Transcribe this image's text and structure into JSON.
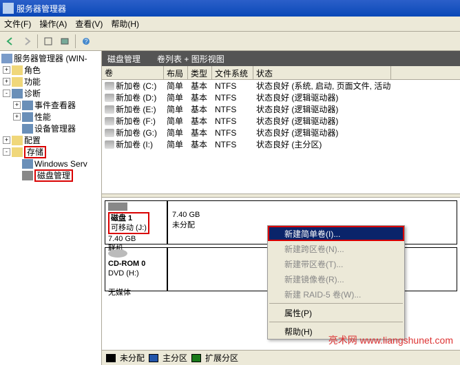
{
  "titlebar": {
    "title": "服务器管理器"
  },
  "menubar": {
    "file": "文件(F)",
    "action": "操作(A)",
    "view": "查看(V)",
    "help": "帮助(H)"
  },
  "tree": {
    "root": "服务器管理器 (WIN-",
    "roles": "角色",
    "features": "功能",
    "diag": "诊断",
    "eventviewer": "事件查看器",
    "perf": "性能",
    "devmgr": "设备管理器",
    "config": "配置",
    "storage": "存储",
    "winserv": "Windows Serv",
    "diskmgmt": "磁盘管理"
  },
  "header": {
    "title": "磁盘管理",
    "sub": "卷列表 + 图形视图"
  },
  "cols": {
    "vol": "卷",
    "layout": "布局",
    "type": "类型",
    "fs": "文件系统",
    "status": "状态"
  },
  "volumes": [
    {
      "name": "新加卷 (C:)",
      "layout": "简单",
      "type": "基本",
      "fs": "NTFS",
      "status": "状态良好 (系统, 启动, 页面文件, 活动, 故障转储,"
    },
    {
      "name": "新加卷 (D:)",
      "layout": "简单",
      "type": "基本",
      "fs": "NTFS",
      "status": "状态良好 (逻辑驱动器)"
    },
    {
      "name": "新加卷 (E:)",
      "layout": "简单",
      "type": "基本",
      "fs": "NTFS",
      "status": "状态良好 (逻辑驱动器)"
    },
    {
      "name": "新加卷 (F:)",
      "layout": "简单",
      "type": "基本",
      "fs": "NTFS",
      "status": "状态良好 (逻辑驱动器)"
    },
    {
      "name": "新加卷 (G:)",
      "layout": "简单",
      "type": "基本",
      "fs": "NTFS",
      "status": "状态良好 (逻辑驱动器)"
    },
    {
      "name": "新加卷 (I:)",
      "layout": "简单",
      "type": "基本",
      "fs": "NTFS",
      "status": "状态良好 (主分区)"
    }
  ],
  "disk1": {
    "title": "磁盘 1",
    "type": "可移动 (J:)",
    "size": "7.40 GB",
    "state": "联机",
    "part_size": "7.40 GB",
    "part_state": "未分配"
  },
  "cdrom": {
    "title": "CD-ROM 0",
    "type": "DVD (H:)",
    "state": "无媒体"
  },
  "ctx": {
    "simple": "新建简单卷(I)...",
    "span": "新建跨区卷(N)...",
    "stripe": "新建带区卷(T)...",
    "mirror": "新建镜像卷(R)...",
    "raid5": "新建 RAID-5 卷(W)...",
    "prop": "属性(P)",
    "help": "帮助(H)"
  },
  "legend": {
    "unalloc": "未分配",
    "primary": "主分区",
    "extended": "扩展分区"
  },
  "watermark": "亮术网  www.liangshunet.com"
}
